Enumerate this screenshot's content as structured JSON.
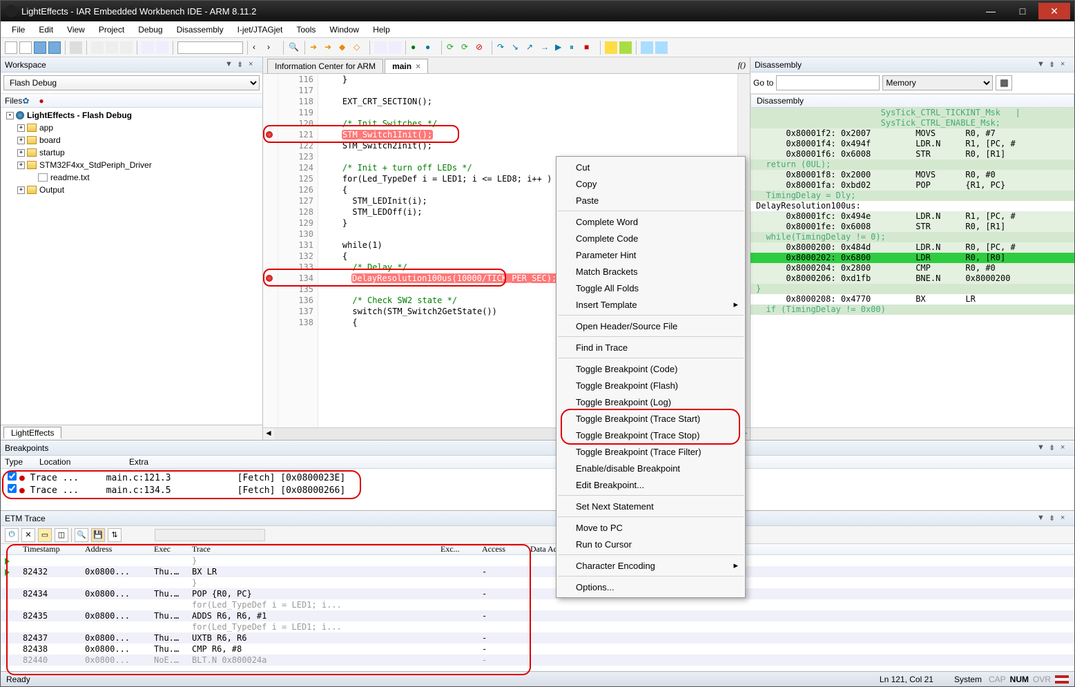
{
  "window": {
    "title": "LightEffects - IAR Embedded Workbench IDE - ARM 8.11.2"
  },
  "menubar": [
    "File",
    "Edit",
    "View",
    "Project",
    "Debug",
    "Disassembly",
    "I-jet/JTAGjet",
    "Tools",
    "Window",
    "Help"
  ],
  "workspace": {
    "panel_title": "Workspace",
    "config_dropdown": "Flash Debug",
    "files_header": "Files",
    "tree": [
      {
        "depth": 0,
        "pm": "-",
        "icon": "proj",
        "label": "LightEffects - Flash Debug",
        "bold": true
      },
      {
        "depth": 1,
        "pm": "+",
        "icon": "folder",
        "label": "app"
      },
      {
        "depth": 1,
        "pm": "+",
        "icon": "folder",
        "label": "board"
      },
      {
        "depth": 1,
        "pm": "+",
        "icon": "folder",
        "label": "startup"
      },
      {
        "depth": 1,
        "pm": "+",
        "icon": "folder",
        "label": "STM32F4xx_StdPeriph_Driver"
      },
      {
        "depth": 2,
        "pm": "",
        "icon": "file",
        "label": "readme.txt"
      },
      {
        "depth": 1,
        "pm": "+",
        "icon": "folder",
        "label": "Output"
      }
    ],
    "bottom_tab": "LightEffects"
  },
  "editor": {
    "tabs": [
      {
        "label": "Information Center for ARM",
        "active": false,
        "closable": false
      },
      {
        "label": "main",
        "active": true,
        "closable": true
      }
    ],
    "fx_label": "f()",
    "lines": [
      {
        "n": 116,
        "t": "    }"
      },
      {
        "n": 117,
        "t": ""
      },
      {
        "n": 118,
        "t": "    EXT_CRT_SECTION();"
      },
      {
        "n": 119,
        "t": ""
      },
      {
        "n": 120,
        "t": "    /* Init Switches */",
        "cls": "cmt"
      },
      {
        "n": 121,
        "t": "    STM_Switch1Init();",
        "bp": true,
        "hl": true
      },
      {
        "n": 122,
        "t": "    STM_Switch2Init();"
      },
      {
        "n": 123,
        "t": ""
      },
      {
        "n": 124,
        "t": "    /* Init + turn off LEDs */",
        "cls": "cmt"
      },
      {
        "n": 125,
        "t": "    for(Led_TypeDef i = LED1; i <= LED8; i++ )"
      },
      {
        "n": 126,
        "t": "    {"
      },
      {
        "n": 127,
        "t": "      STM_LEDInit(i);"
      },
      {
        "n": 128,
        "t": "      STM_LEDOff(i);"
      },
      {
        "n": 129,
        "t": "    }"
      },
      {
        "n": 130,
        "t": ""
      },
      {
        "n": 131,
        "t": "    while(1)"
      },
      {
        "n": 132,
        "t": "    {"
      },
      {
        "n": 133,
        "t": "      /* Delay */",
        "cls": "cmt"
      },
      {
        "n": 134,
        "t": "      DelayResolution100us(10000/TICK_PER_SEC);",
        "bp": true,
        "hl": true
      },
      {
        "n": 135,
        "t": ""
      },
      {
        "n": 136,
        "t": "      /* Check SW2 state */",
        "cls": "cmt"
      },
      {
        "n": 137,
        "t": "      switch(STM_Switch2GetState())"
      },
      {
        "n": 138,
        "t": "      {"
      }
    ]
  },
  "disassembly": {
    "panel_title": "Disassembly",
    "goto_label": "Go to",
    "memory_dropdown": "Memory",
    "header": "Disassembly",
    "lines": [
      {
        "t": "                         SysTick_CTRL_TICKINT_Msk   |",
        "cls": "da-gl"
      },
      {
        "t": "                         SysTick_CTRL_ENABLE_Msk;",
        "cls": "da-gl"
      },
      {
        "t": "      0x80001f2: 0x2007         MOVS      R0, #7",
        "cls": "da-g"
      },
      {
        "t": "      0x80001f4: 0x494f         LDR.N     R1, [PC, #",
        "cls": "da-g"
      },
      {
        "t": "      0x80001f6: 0x6008         STR       R0, [R1]",
        "cls": "da-g"
      },
      {
        "t": "  return (0UL);",
        "cls": "da-gl"
      },
      {
        "t": "      0x80001f8: 0x2000         MOVS      R0, #0",
        "cls": "da-g"
      },
      {
        "t": "      0x80001fa: 0xbd02         POP       {R1, PC}",
        "cls": "da-g"
      },
      {
        "t": "  TimingDelay = Dly;",
        "cls": "da-gl"
      },
      {
        "t": "DelayResolution100us:",
        "cls": ""
      },
      {
        "t": "      0x80001fc: 0x494e         LDR.N     R1, [PC, #",
        "cls": "da-g"
      },
      {
        "t": "      0x80001fe: 0x6008         STR       R0, [R1]",
        "cls": "da-g"
      },
      {
        "t": "  while(TimingDelay != 0);",
        "cls": "da-gl"
      },
      {
        "t": "      0x8000200: 0x484d         LDR.N     R0, [PC, #",
        "cls": "da-g"
      },
      {
        "t": "      0x8000202: 0x6800         LDR       R0, [R0]",
        "cls": "da-hl"
      },
      {
        "t": "      0x8000204: 0x2800         CMP       R0, #0",
        "cls": "da-g"
      },
      {
        "t": "      0x8000206: 0xd1fb         BNE.N     0x8000200",
        "cls": "da-g"
      },
      {
        "t": "}",
        "cls": "da-gl"
      },
      {
        "t": "      0x8000208: 0x4770         BX        LR",
        "cls": ""
      },
      {
        "t": "  if (TimingDelay != 0x00)",
        "cls": "da-gl"
      }
    ]
  },
  "breakpoints": {
    "panel_title": "Breakpoints",
    "columns": [
      "Type",
      "Location",
      "Extra"
    ],
    "rows": [
      {
        "type": "Trace ...",
        "location": "main.c:121.3",
        "extra": "[Fetch] [0x0800023E]"
      },
      {
        "type": "Trace ...",
        "location": "main.c:134.5",
        "extra": "[Fetch] [0x08000266]"
      }
    ]
  },
  "etm": {
    "panel_title": "ETM Trace",
    "columns": [
      "",
      "Timestamp",
      "Address",
      "Exec",
      "Trace",
      "",
      "Exc...",
      "Access",
      "Data Address"
    ],
    "rows": [
      {
        "ga": true,
        "ts": "",
        "addr": "",
        "exec": "",
        "trace": "        }",
        "dash": "",
        "stripe": false,
        "dim": true
      },
      {
        "ga": true,
        "ts": "82432",
        "addr": "0x0800...",
        "exec": "Thu...",
        "trace": "BX        LR",
        "dash": "-",
        "stripe": true
      },
      {
        "ts": "",
        "addr": "",
        "exec": "",
        "trace": "      }",
        "dash": "",
        "stripe": false,
        "dim": true
      },
      {
        "ts": "82434",
        "addr": "0x0800...",
        "exec": "Thu...",
        "trace": "POP       {R0, PC}",
        "dash": "-",
        "stripe": true
      },
      {
        "ts": "",
        "addr": "",
        "exec": "",
        "trace": "      for(Led_TypeDef i = LED1; i...",
        "dash": "",
        "stripe": false,
        "dim": true
      },
      {
        "ts": "82435",
        "addr": "0x0800...",
        "exec": "Thu...",
        "trace": "ADDS      R6, R6, #1",
        "dash": "-",
        "stripe": true
      },
      {
        "ts": "",
        "addr": "",
        "exec": "",
        "trace": "      for(Led_TypeDef i = LED1; i...",
        "dash": "",
        "stripe": false,
        "dim": true
      },
      {
        "ts": "82437",
        "addr": "0x0800...",
        "exec": "Thu...",
        "trace": "UXTB      R6, R6",
        "dash": "-",
        "stripe": true
      },
      {
        "ts": "82438",
        "addr": "0x0800...",
        "exec": "Thu...",
        "trace": "CMP       R6, #8",
        "dash": "-",
        "stripe": false
      },
      {
        "ts": "82440",
        "addr": "0x0800...",
        "exec": "NoE...",
        "trace": "BLT.N     0x800024a",
        "dash": "-",
        "stripe": true,
        "dim": true
      }
    ]
  },
  "statusbar": {
    "ready": "Ready",
    "pos": "Ln 121, Col 21",
    "system": "System",
    "caps": "CAP",
    "num": "NUM",
    "ovr": "OVR"
  },
  "ctx_menu": {
    "items": [
      {
        "label": "Cut"
      },
      {
        "label": "Copy"
      },
      {
        "label": "Paste"
      },
      {
        "sep": true
      },
      {
        "label": "Complete Word"
      },
      {
        "label": "Complete Code"
      },
      {
        "label": "Parameter Hint"
      },
      {
        "label": "Match Brackets"
      },
      {
        "label": "Toggle All Folds"
      },
      {
        "label": "Insert Template",
        "arrow": true
      },
      {
        "sep": true
      },
      {
        "label": "Open Header/Source File"
      },
      {
        "sep": true
      },
      {
        "label": "Find in Trace"
      },
      {
        "sep": true
      },
      {
        "label": "Toggle Breakpoint (Code)"
      },
      {
        "label": "Toggle Breakpoint (Flash)"
      },
      {
        "label": "Toggle Breakpoint (Log)"
      },
      {
        "label": "Toggle Breakpoint (Trace Start)",
        "ring": true
      },
      {
        "label": "Toggle Breakpoint (Trace Stop)",
        "ring": true
      },
      {
        "label": "Toggle Breakpoint (Trace Filter)"
      },
      {
        "label": "Enable/disable Breakpoint"
      },
      {
        "label": "Edit Breakpoint..."
      },
      {
        "sep": true
      },
      {
        "label": "Set Next Statement"
      },
      {
        "sep": true
      },
      {
        "label": "Move to PC"
      },
      {
        "label": "Run to Cursor"
      },
      {
        "sep": true
      },
      {
        "label": "Character Encoding",
        "arrow": true
      },
      {
        "sep": true
      },
      {
        "label": "Options..."
      }
    ]
  }
}
